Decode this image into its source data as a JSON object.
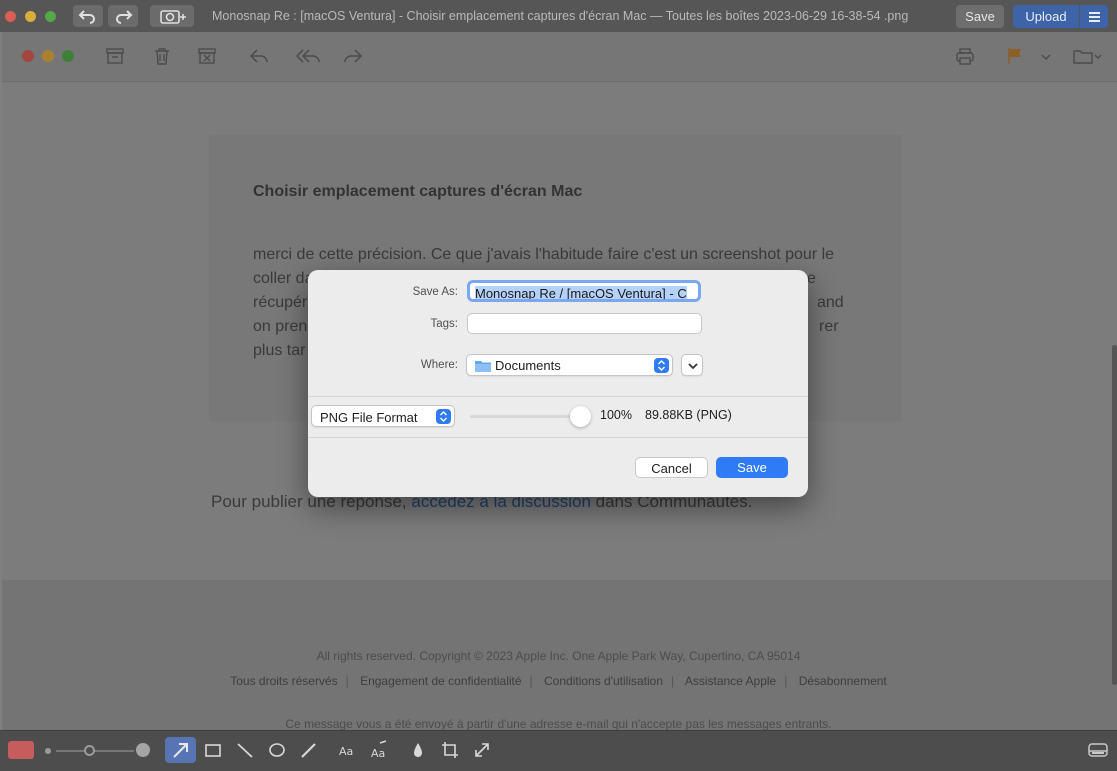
{
  "monosnap": {
    "title": "Monosnap Re : [macOS Ventura] - Choisir emplacement captures d'écran Mac — Toutes les boîtes 2023-06-29 16-38-54  .png",
    "save_label": "Save",
    "upload_label": "Upload"
  },
  "mail": {
    "subject": "Choisir emplacement captures d'écran Mac",
    "body_lines": [
      "merci de cette précision. Ce que j'avais l'habitude faire c'est un screenshot pour le",
      "coller da",
      "récupér",
      "on pren",
      "plus tar"
    ],
    "body_right": [
      "e",
      "and",
      "rer"
    ],
    "reply_prefix": "Pour publier une réponse, ",
    "reply_link": "accédez à la discussion",
    "reply_suffix": " dans Communautés.",
    "copyright": "All rights reserved. Copyright © 2023 Apple Inc. One Apple Park Way, Cupertino, CA 95014",
    "footer_links": [
      "Tous droits réservés",
      "Engagement de confidentialité",
      "Conditions d'utilisation",
      "Assistance Apple",
      "Désabonnement"
    ],
    "notice": "Ce message vous a été envoyé à partir d'une adresse e-mail qui n'accepte pas les messages entrants."
  },
  "dialog": {
    "save_as_label": "Save As:",
    "save_as_value": "Monosnap Re / [macOS Ventura] - C",
    "tags_label": "Tags:",
    "tags_value": "",
    "where_label": "Where:",
    "where_value": "Documents",
    "format_value": "PNG File Format",
    "quality": "100%",
    "size": "89.88KB (PNG)",
    "quality_level": 1.0,
    "cancel_label": "Cancel",
    "save_label": "Save"
  },
  "colors": {
    "accent": "#2f7bf6",
    "upload": "#3f63a8",
    "flag": "#e8922a"
  }
}
